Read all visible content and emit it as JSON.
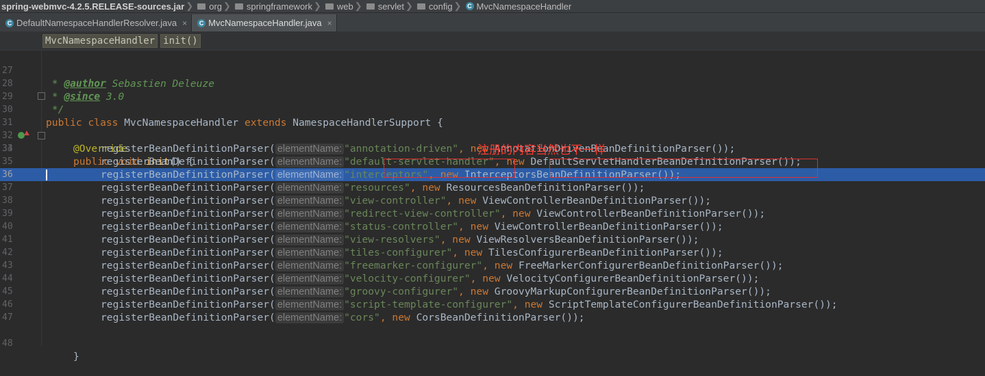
{
  "breadcrumb": {
    "jar": "spring-webmvc-4.2.5.RELEASE-sources.jar",
    "folders": [
      "org",
      "springframework",
      "web",
      "servlet",
      "config"
    ],
    "class": "MvcNamespaceHandler",
    "class_icon": "C"
  },
  "tabs": [
    {
      "label": "DefaultNamespaceHandlerResolver.java",
      "close": "×",
      "icon": "C"
    },
    {
      "label": "MvcNamespaceHandler.java",
      "close": "×",
      "icon": "C"
    }
  ],
  "method_bar": {
    "class_chip": "MvcNamespaceHandler",
    "method_chip": "init()"
  },
  "note": "注册的内容当然也不一样",
  "code": {
    "l27": {
      "n": "27",
      "star": " * ",
      "tag": "@author",
      "text": " Sebastien Deleuze"
    },
    "l28": {
      "n": "28",
      "star": " * ",
      "tag": "@since",
      "text": " 3.0"
    },
    "l29": {
      "n": "29",
      "text": " */"
    },
    "l30": {
      "n": "30",
      "kw1": "public class ",
      "name": "MvcNamespaceHandler ",
      "kw2": "extends ",
      "rest": "NamespaceHandlerSupport {"
    },
    "l31": {
      "n": "31"
    },
    "l32": {
      "n": "32",
      "ann": "@Override"
    },
    "l33": {
      "n": "33",
      "kw": "public void ",
      "fn": "init",
      "rest": "() {"
    },
    "call": "registerBeanDefinitionParser(",
    "hint": "elementName:",
    "kw_new": "new ",
    "parsers": [
      {
        "n": "34",
        "str": "\"annotation-driven\"",
        "cls": "AnnotationDrivenBeanDefinitionParser());"
      },
      {
        "n": "35",
        "str": "\"default-servlet-handler\"",
        "cls": "DefaultServletHandlerBeanDefinitionParser());"
      },
      {
        "n": "36",
        "str": "\"interceptors\"",
        "cls": "InterceptorsBeanDefinitionParser());"
      },
      {
        "n": "37",
        "str": "\"resources\"",
        "cls": "ResourcesBeanDefinitionParser());"
      },
      {
        "n": "38",
        "str": "\"view-controller\"",
        "cls": "ViewControllerBeanDefinitionParser());"
      },
      {
        "n": "39",
        "str": "\"redirect-view-controller\"",
        "cls": "ViewControllerBeanDefinitionParser());"
      },
      {
        "n": "40",
        "str": "\"status-controller\"",
        "cls": "ViewControllerBeanDefinitionParser());"
      },
      {
        "n": "41",
        "str": "\"view-resolvers\"",
        "cls": "ViewResolversBeanDefinitionParser());"
      },
      {
        "n": "42",
        "str": "\"tiles-configurer\"",
        "cls": "TilesConfigurerBeanDefinitionParser());"
      },
      {
        "n": "43",
        "str": "\"freemarker-configurer\"",
        "cls": "FreeMarkerConfigurerBeanDefinitionParser());"
      },
      {
        "n": "44",
        "str": "\"velocity-configurer\"",
        "cls": "VelocityConfigurerBeanDefinitionParser());"
      },
      {
        "n": "45",
        "str": "\"groovy-configurer\"",
        "cls": "GroovyMarkupConfigurerBeanDefinitionParser());"
      },
      {
        "n": "46",
        "str": "\"script-template-configurer\"",
        "cls": "ScriptTemplateConfigurerBeanDefinitionParser());"
      },
      {
        "n": "47",
        "str": "\"cors\"",
        "cls": "CorsBeanDefinitionParser());"
      }
    ],
    "close_brace": "}",
    "selected_line": "36"
  },
  "colors": {
    "background": "#2b2b2b",
    "selection": "#2d5ca7",
    "annotation_red": "#ff3b30"
  }
}
